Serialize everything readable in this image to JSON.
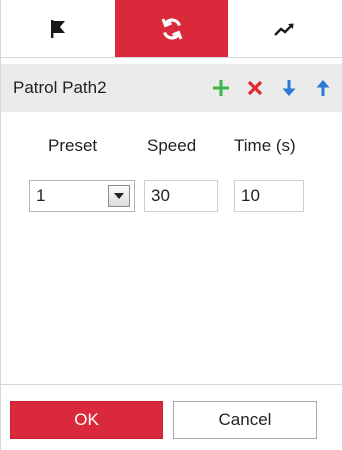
{
  "tabs": [
    {
      "icon": "flag-icon",
      "active": false
    },
    {
      "icon": "refresh-icon",
      "active": true
    },
    {
      "icon": "trend-icon",
      "active": false
    }
  ],
  "colors": {
    "accent": "#d9293a",
    "add": "#3cb44a",
    "delete": "#e0292d",
    "move": "#2a7ad6",
    "toolbar_bg": "#ebebeb"
  },
  "toolbar": {
    "path_name": "Patrol Path2",
    "icons": [
      "add-icon",
      "delete-icon",
      "move-down-icon",
      "move-up-icon"
    ]
  },
  "columns": {
    "preset": "Preset",
    "speed": "Speed",
    "time": "Time (s)"
  },
  "row": {
    "preset": "1",
    "speed": "30",
    "time": "10"
  },
  "buttons": {
    "ok": "OK",
    "cancel": "Cancel"
  }
}
